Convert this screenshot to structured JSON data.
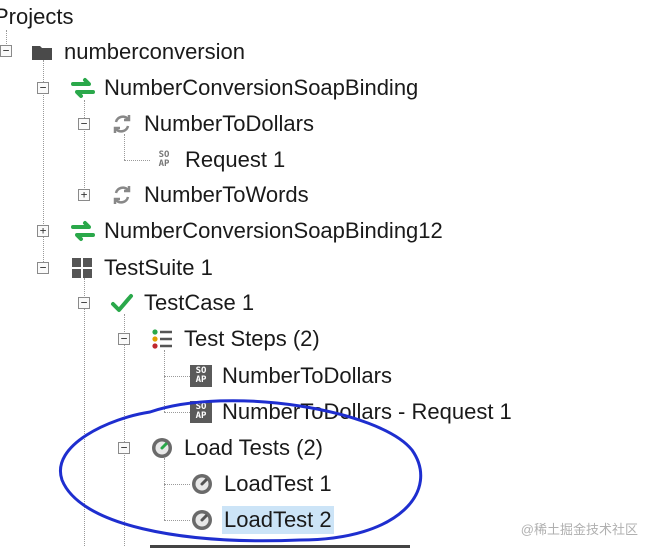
{
  "tree": {
    "root_label": "Projects",
    "project": "numberconversion",
    "binding_1": "NumberConversionSoapBinding",
    "op_to_dollars": "NumberToDollars",
    "request_1": "Request 1",
    "op_to_words": "NumberToWords",
    "binding_12": "NumberConversionSoapBinding12",
    "test_suite": "TestSuite 1",
    "test_case": "TestCase 1",
    "test_steps": "Test Steps (2)",
    "step_1": "NumberToDollars",
    "step_2": "NumberToDollars - Request 1",
    "load_tests": "Load Tests (2)",
    "load_test_1": "LoadTest 1",
    "load_test_2": "LoadTest 2"
  },
  "icons": {
    "soap_top": "SO",
    "soap_bottom": "AP"
  },
  "watermark": "@稀土掘金技术社区",
  "colors": {
    "selection": "#cce4f7",
    "annotation_circle": "#1e2ecf",
    "binding_icon": "#2aa84a",
    "check_icon": "#2aa84a"
  }
}
